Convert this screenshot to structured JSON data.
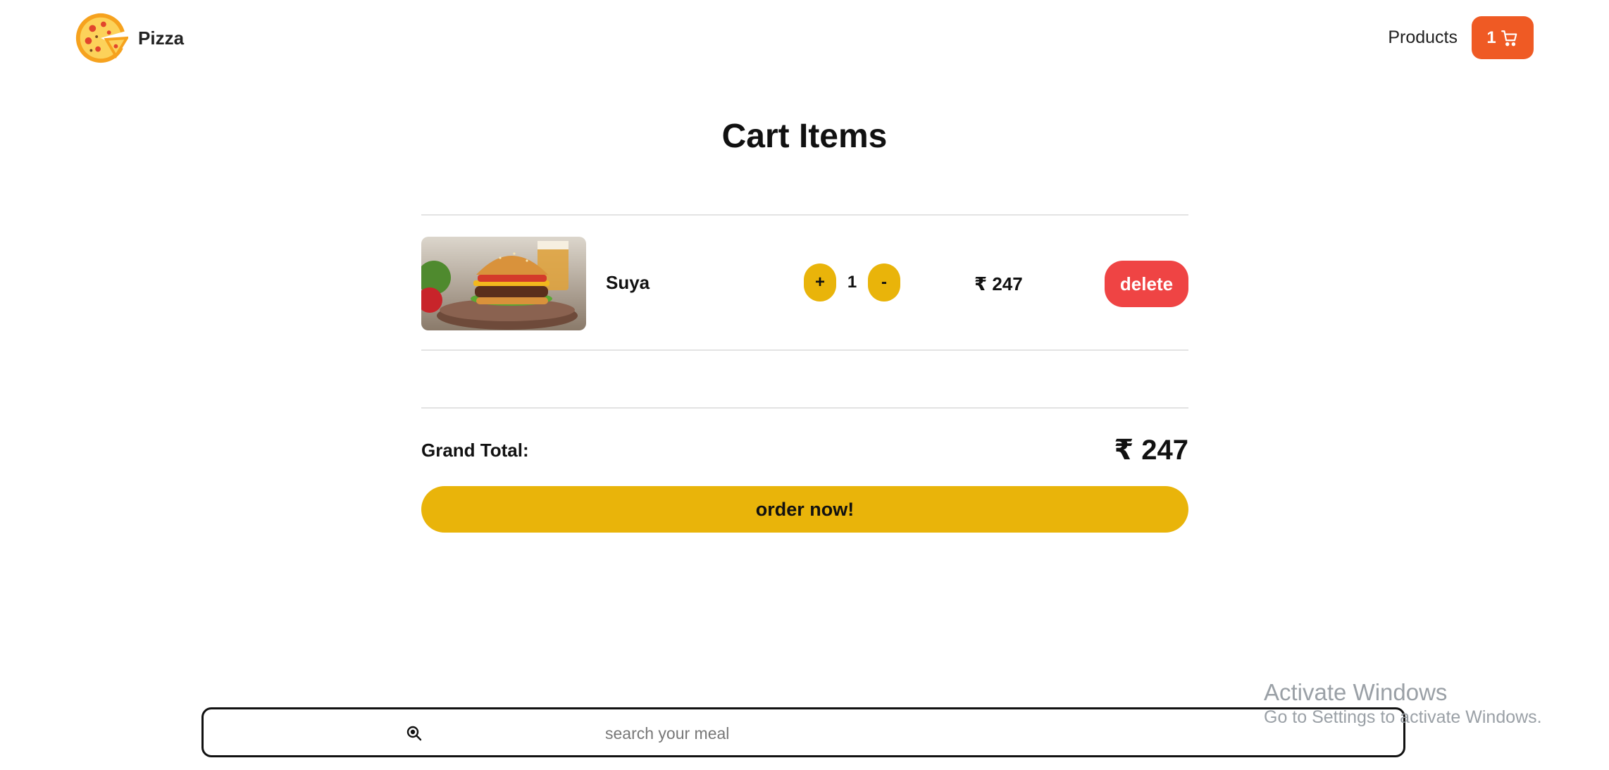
{
  "header": {
    "brand": {
      "name": "Pizza",
      "logo_icon": "pizza-icon"
    },
    "nav": {
      "products_label": "Products",
      "cart_count": "1",
      "cart_icon": "cart-icon",
      "cart_color": "#ef5a24"
    }
  },
  "page": {
    "title": "Cart Items"
  },
  "cart": {
    "items": [
      {
        "name": "Suya",
        "image_icon": "burger-photo",
        "increment_label": "+",
        "quantity": "1",
        "decrement_label": "-",
        "price": "₹ 247",
        "delete_label": "delete"
      }
    ],
    "grand_total_label": "Grand Total:",
    "grand_total_value": "₹ 247",
    "order_label": "order now!"
  },
  "search": {
    "placeholder": "search your meal",
    "icon": "search-icon"
  },
  "watermark": {
    "title": "Activate Windows",
    "subtitle": "Go to Settings to activate Windows."
  },
  "colors": {
    "accent_yellow": "#e9b40a",
    "delete_red": "#ef4444",
    "cart_orange": "#ef5a24"
  }
}
